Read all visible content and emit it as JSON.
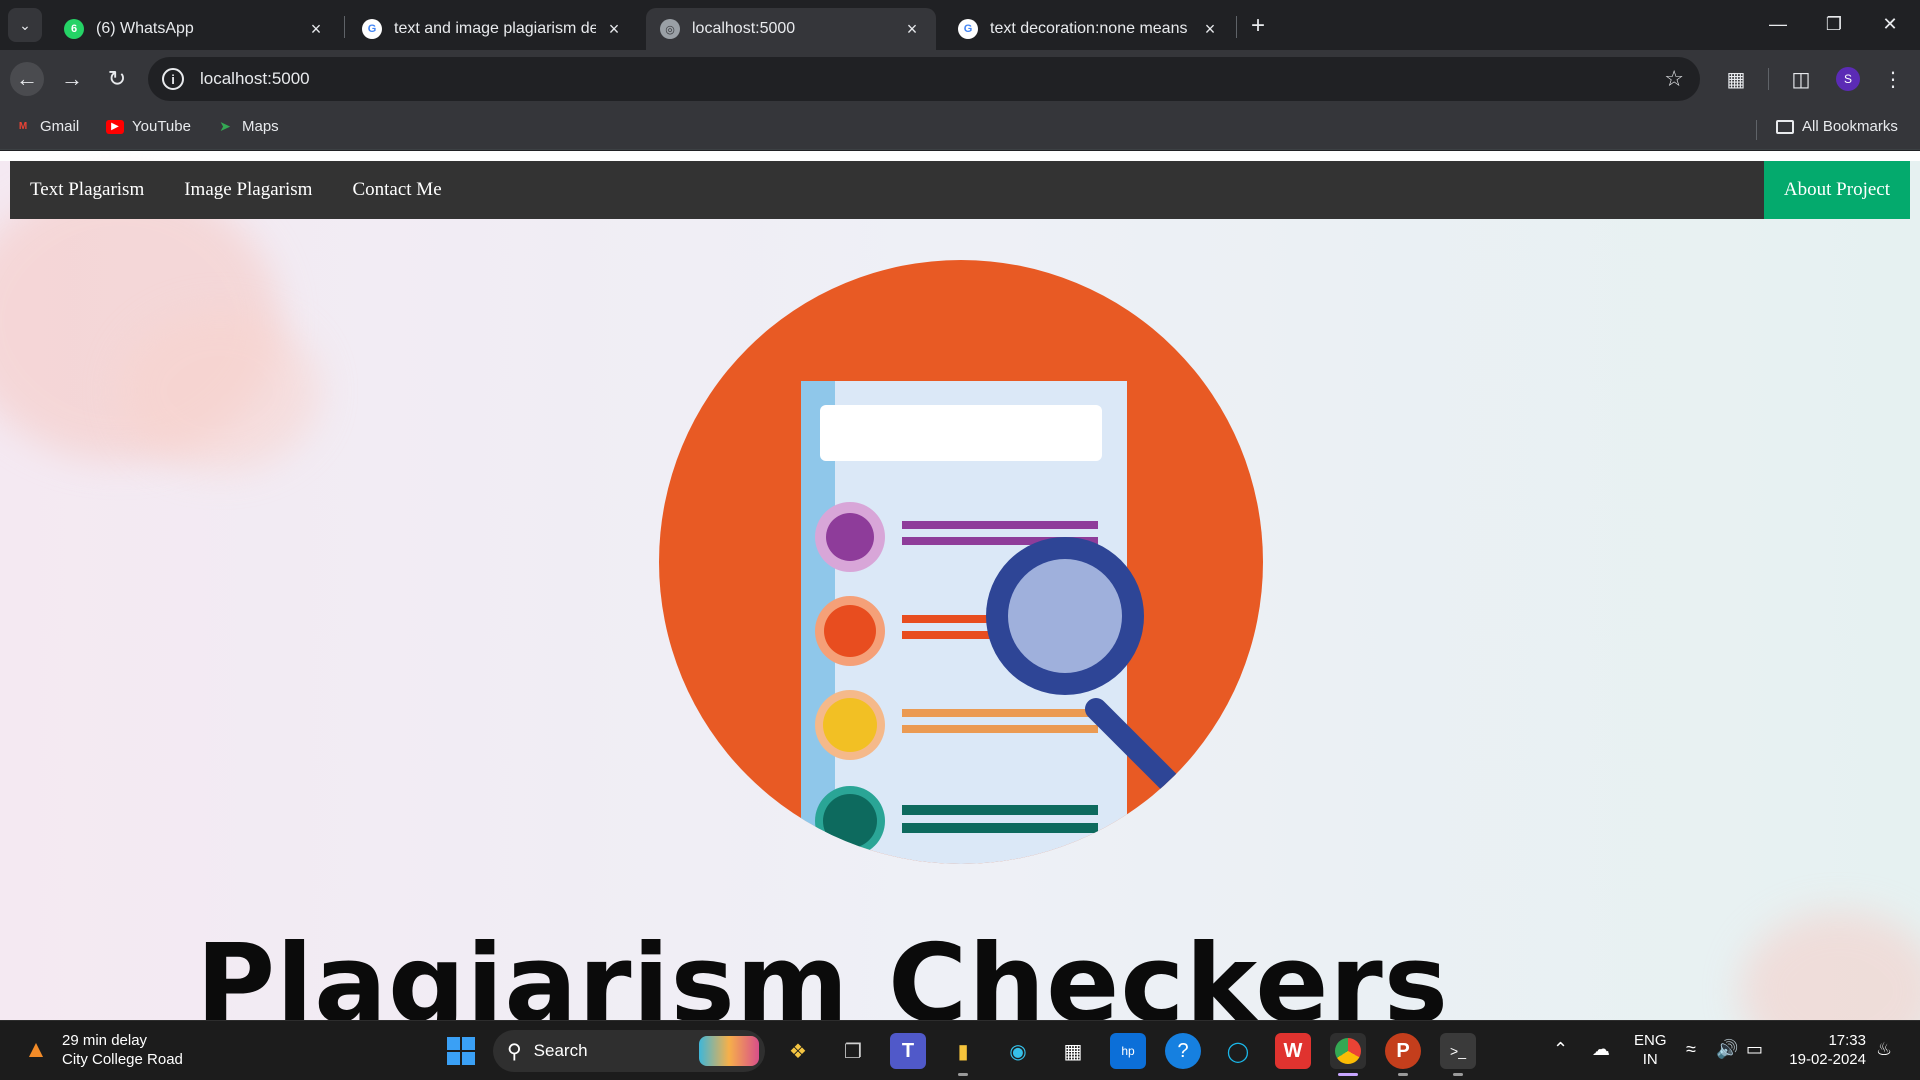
{
  "browser": {
    "tabs": [
      {
        "title": "(6) WhatsApp",
        "favicon": "whatsapp-icon",
        "badge": "6",
        "active": false
      },
      {
        "title": "text and image plagiarism dete",
        "favicon": "google-icon",
        "active": false
      },
      {
        "title": "localhost:5000",
        "favicon": "globe-icon",
        "active": true
      },
      {
        "title": "text decoration:none means me",
        "favicon": "google-icon",
        "active": false
      }
    ],
    "address": "localhost:5000",
    "profile_initial": "S",
    "bookmarks": [
      {
        "label": "Gmail",
        "icon": "gmail-icon"
      },
      {
        "label": "YouTube",
        "icon": "youtube-icon"
      },
      {
        "label": "Maps",
        "icon": "maps-icon"
      }
    ],
    "all_bookmarks": "All Bookmarks"
  },
  "site": {
    "nav": {
      "text_plagarism": "Text Plagarism",
      "image_plagarism": "Image Plagarism",
      "contact": "Contact Me",
      "about": "About Project"
    },
    "headline": "Plagiarism Checkers",
    "colors": {
      "nav_bg": "#333333",
      "about_bg": "#04aa6d",
      "circle": "#e85a24",
      "magnifier": "#2e4596"
    }
  },
  "taskbar": {
    "weather_line1": "29 min delay",
    "weather_line2": "City College Road",
    "search_label": "Search",
    "lang_line1": "ENG",
    "lang_line2": "IN",
    "time": "17:33",
    "date": "19-02-2024"
  }
}
